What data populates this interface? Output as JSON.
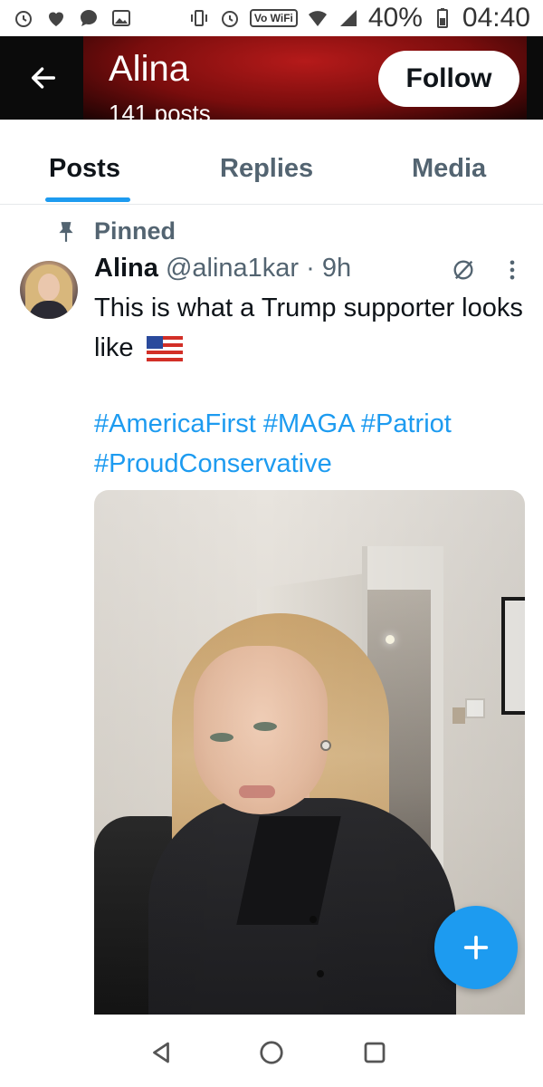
{
  "status_bar": {
    "battery": "40%",
    "time": "04:40",
    "volte": "Vo WiFi"
  },
  "header": {
    "name": "Alina",
    "posts_count": "141 posts",
    "follow_label": "Follow"
  },
  "tabs": [
    {
      "label": "Posts",
      "active": true
    },
    {
      "label": "Replies",
      "active": false
    },
    {
      "label": "Media",
      "active": false
    }
  ],
  "post": {
    "pinned_label": "Pinned",
    "author_name": "Alina",
    "handle": "@alina1kar",
    "separator": "·",
    "time": "9h",
    "text": "This is what a Trump supporter looks like",
    "hashtags": "#AmericaFirst #MAGA #Patriot #ProudConservative"
  },
  "colors": {
    "accent": "#1d9bf0",
    "text_primary": "#0f1419",
    "text_secondary": "#536471"
  },
  "icons": {
    "back": "arrow-left-icon",
    "pin": "pin-icon",
    "grok": "grok-icon",
    "more": "more-vertical-icon",
    "flag": "us-flag-icon",
    "compose": "plus-icon"
  }
}
